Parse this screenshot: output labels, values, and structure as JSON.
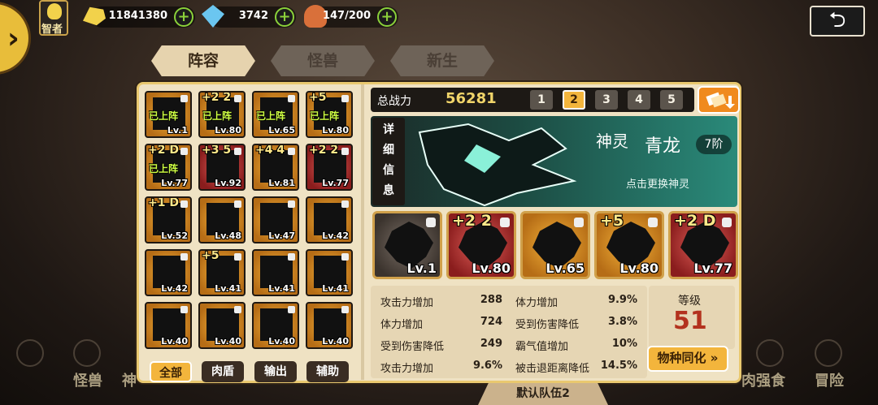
{
  "top": {
    "sage_label": "智者",
    "gold": "11841380",
    "gems": "3742",
    "meat": "147/200",
    "plus": "+",
    "side_arrow": "›",
    "back_glyph": "⮌"
  },
  "tabs": [
    {
      "label": "阵容",
      "active": true
    },
    {
      "label": "怪兽",
      "active": false
    },
    {
      "label": "新生",
      "active": false
    }
  ],
  "roster": [
    {
      "rank": "",
      "lv": "Lv.1",
      "deployed": "已上阵",
      "frame": "gold"
    },
    {
      "rank": "+2 2",
      "lv": "Lv.80",
      "deployed": "已上阵",
      "frame": "gold"
    },
    {
      "rank": "",
      "lv": "Lv.65",
      "deployed": "已上阵",
      "frame": "gold"
    },
    {
      "rank": "+5",
      "lv": "Lv.80",
      "deployed": "已上阵",
      "frame": "gold"
    },
    {
      "rank": "+2 D",
      "lv": "Lv.77",
      "deployed": "已上阵",
      "frame": "gold"
    },
    {
      "rank": "+3 5",
      "lv": "Lv.92",
      "deployed": "",
      "frame": "red"
    },
    {
      "rank": "+4 4",
      "lv": "Lv.81",
      "deployed": "",
      "frame": "gold"
    },
    {
      "rank": "+2 2",
      "lv": "Lv.77",
      "deployed": "",
      "frame": "red"
    },
    {
      "rank": "+1 D",
      "lv": "Lv.52",
      "deployed": "",
      "frame": "gold"
    },
    {
      "rank": "",
      "lv": "Lv.48",
      "deployed": "",
      "frame": "gold"
    },
    {
      "rank": "",
      "lv": "Lv.47",
      "deployed": "",
      "frame": "gold"
    },
    {
      "rank": "",
      "lv": "Lv.42",
      "deployed": "",
      "frame": "gold"
    },
    {
      "rank": "",
      "lv": "Lv.42",
      "deployed": "",
      "frame": "gold"
    },
    {
      "rank": "+5",
      "lv": "Lv.41",
      "deployed": "",
      "frame": "gold"
    },
    {
      "rank": "",
      "lv": "Lv.41",
      "deployed": "",
      "frame": "gold"
    },
    {
      "rank": "",
      "lv": "Lv.41",
      "deployed": "",
      "frame": "gold"
    },
    {
      "rank": "",
      "lv": "Lv.40",
      "deployed": "",
      "frame": "gold"
    },
    {
      "rank": "",
      "lv": "Lv.40",
      "deployed": "",
      "frame": "gold"
    },
    {
      "rank": "",
      "lv": "Lv.40",
      "deployed": "",
      "frame": "gold"
    },
    {
      "rank": "",
      "lv": "Lv.40",
      "deployed": "",
      "frame": "gold"
    }
  ],
  "filters": [
    "全部",
    "肉盾",
    "输出",
    "辅助"
  ],
  "power": {
    "label": "总战力",
    "value": "56281",
    "slots": [
      "1",
      "2",
      "3",
      "4",
      "5"
    ],
    "active_slot": "2"
  },
  "detail": {
    "label_chars": [
      "详",
      "细",
      "信",
      "息"
    ],
    "kind": "神灵",
    "name": "青龙",
    "order": "7阶",
    "hint": "点击更换神灵"
  },
  "team": [
    {
      "rank": "",
      "lv": "Lv.1",
      "frame": "dark"
    },
    {
      "rank": "+2 2",
      "lv": "Lv.80",
      "frame": "red"
    },
    {
      "rank": "",
      "lv": "Lv.65",
      "frame": "gold"
    },
    {
      "rank": "+5",
      "lv": "Lv.80",
      "frame": "gold"
    },
    {
      "rank": "+2 D",
      "lv": "Lv.77",
      "frame": "red"
    }
  ],
  "stats": [
    {
      "name": "攻击力增加",
      "value": "288"
    },
    {
      "name": "体力增加",
      "value": "9.9%"
    },
    {
      "name": "体力增加",
      "value": "724"
    },
    {
      "name": "受到伤害降低",
      "value": "3.8%"
    },
    {
      "name": "受到伤害降低",
      "value": "249"
    },
    {
      "name": "霸气值增加",
      "value": "10%"
    },
    {
      "name": "攻击力增加",
      "value": "9.6%"
    },
    {
      "name": "被击退距离降低",
      "value": "14.5%"
    }
  ],
  "level": {
    "label": "等级",
    "value": "51"
  },
  "sync_button": "物种同化 »",
  "team_tab": "默认队伍2",
  "bottom_nav": [
    "怪兽",
    "神",
    "肉强食",
    "冒险"
  ]
}
